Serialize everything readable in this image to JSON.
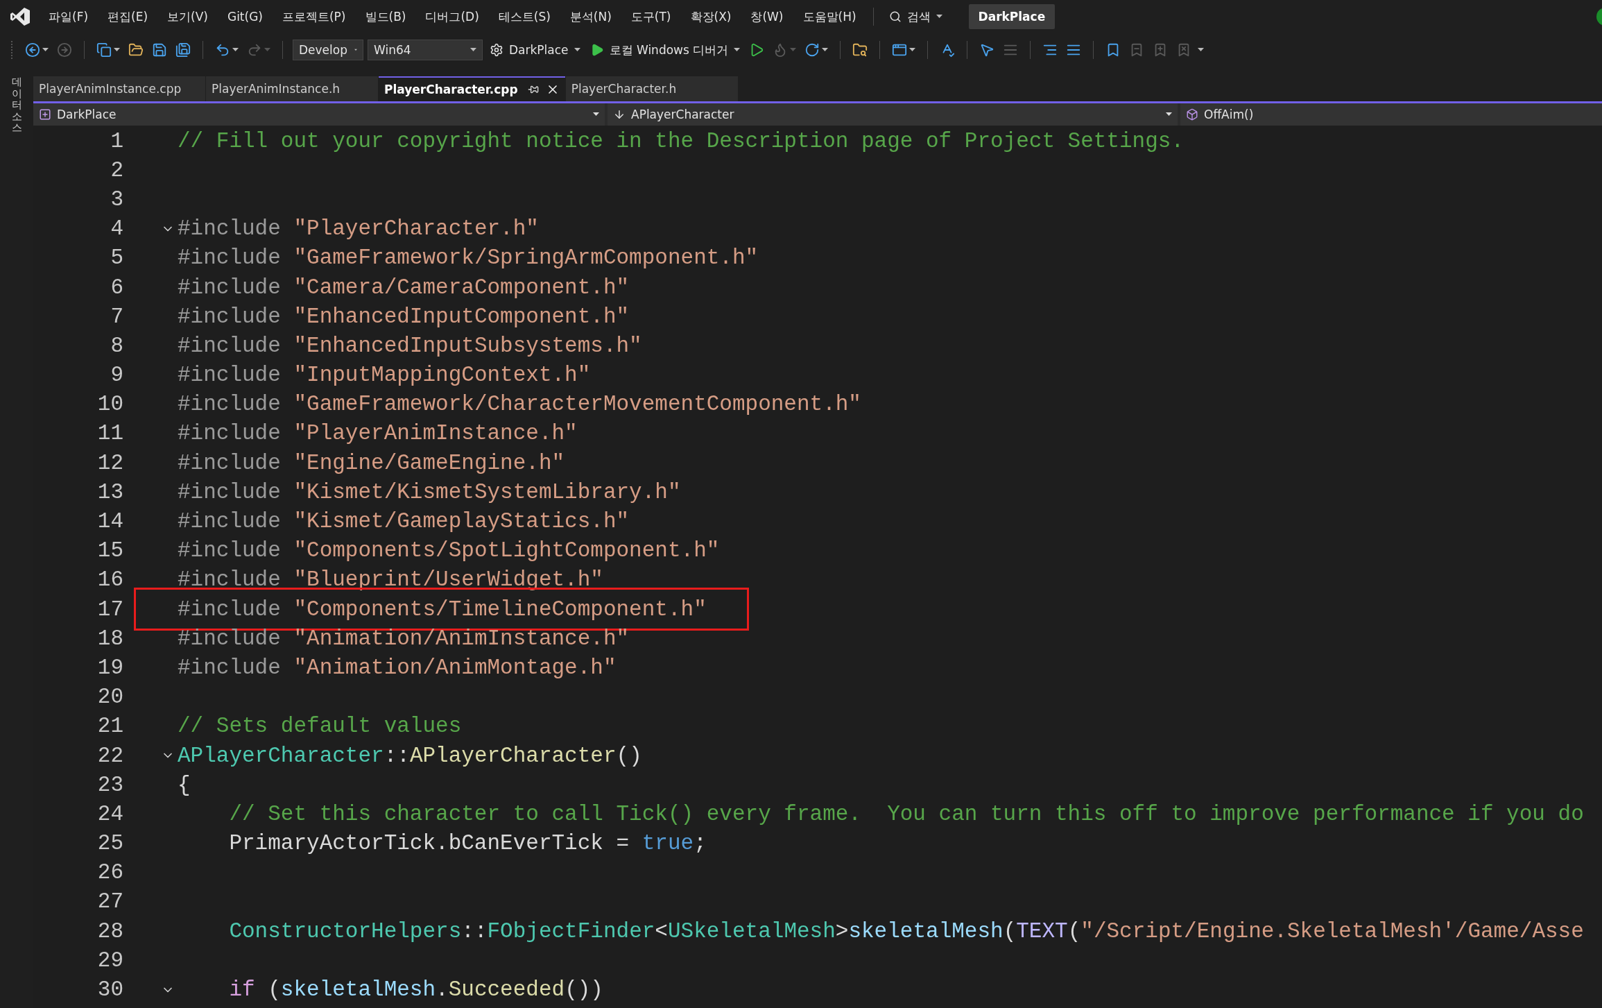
{
  "menu": [
    "파일(F)",
    "편집(E)",
    "보기(V)",
    "Git(G)",
    "프로젝트(P)",
    "빌드(B)",
    "디버그(D)",
    "테스트(S)",
    "분석(N)",
    "도구(T)",
    "확장(X)",
    "창(W)",
    "도움말(H)"
  ],
  "search": {
    "label": "검색"
  },
  "solution_badge": "DarkPlace",
  "toolbar": [
    {
      "kind": "back",
      "disabled": false
    },
    {
      "kind": "forward",
      "disabled": true
    },
    {
      "kind": "separator"
    },
    {
      "kind": "new-item",
      "disabled": false
    },
    {
      "kind": "open",
      "disabled": false
    },
    {
      "kind": "save",
      "disabled": false
    },
    {
      "kind": "save-all",
      "disabled": false
    },
    {
      "kind": "separator"
    },
    {
      "kind": "undo",
      "disabled": false
    },
    {
      "kind": "redo",
      "disabled": true
    },
    {
      "kind": "separator"
    },
    {
      "kind": "combo",
      "label": "Develop",
      "wide": false
    },
    {
      "kind": "combo",
      "label": "Win64",
      "wide": true
    },
    {
      "kind": "startup",
      "label": "DarkPlace"
    },
    {
      "kind": "start",
      "label": "로컬 Windows 디버거"
    },
    {
      "kind": "start-plain",
      "disabled": false
    },
    {
      "kind": "hot-reload",
      "disabled": true
    },
    {
      "kind": "restart",
      "disabled": false
    },
    {
      "kind": "separator"
    },
    {
      "kind": "folder-search",
      "disabled": false
    },
    {
      "kind": "separator"
    },
    {
      "kind": "window",
      "disabled": false
    },
    {
      "kind": "separator"
    },
    {
      "kind": "spell",
      "disabled": false
    },
    {
      "kind": "separator"
    },
    {
      "kind": "pointer",
      "disabled": false
    },
    {
      "kind": "format",
      "disabled": true
    },
    {
      "kind": "separator"
    },
    {
      "kind": "indent",
      "disabled": false
    },
    {
      "kind": "outdent",
      "disabled": false
    },
    {
      "kind": "separator"
    },
    {
      "kind": "bookmark",
      "disabled": false
    },
    {
      "kind": "bookmark-prev",
      "disabled": true
    },
    {
      "kind": "bookmark-next",
      "disabled": true
    },
    {
      "kind": "bookmark-clear",
      "disabled": true
    },
    {
      "kind": "overflow"
    }
  ],
  "side_panel": {
    "label": "데이터 소스"
  },
  "tabs": [
    {
      "label": "PlayerAnimInstance.cpp",
      "selected": false
    },
    {
      "label": "PlayerAnimInstance.h",
      "selected": false
    },
    {
      "label": "PlayerCharacter.cpp",
      "selected": true
    },
    {
      "label": "PlayerCharacter.h",
      "selected": false
    }
  ],
  "navigation": {
    "project": "DarkPlace",
    "scope": "APlayerCharacter",
    "member": "OffAim()"
  },
  "code": {
    "lines": [
      {
        "number": "1",
        "fold": false,
        "boxed": false,
        "tokens": [
          {
            "kind": "comment",
            "text": "// Fill out your copyright notice in the Description page of Project Settings."
          }
        ]
      },
      {
        "number": "2",
        "fold": false,
        "boxed": false
      },
      {
        "number": "3",
        "fold": false,
        "boxed": false
      },
      {
        "number": "4",
        "fold": true,
        "boxed": false,
        "tokens": [
          {
            "kind": "directive",
            "text": "#include "
          },
          {
            "kind": "string",
            "text": "\"PlayerCharacter.h\""
          }
        ]
      },
      {
        "number": "5",
        "fold": false,
        "boxed": false,
        "tokens": [
          {
            "kind": "directive",
            "text": "#include "
          },
          {
            "kind": "string",
            "text": "\"GameFramework/SpringArmComponent.h\""
          }
        ]
      },
      {
        "number": "6",
        "fold": false,
        "boxed": false,
        "tokens": [
          {
            "kind": "directive",
            "text": "#include "
          },
          {
            "kind": "string",
            "text": "\"Camera/CameraComponent.h\""
          }
        ]
      },
      {
        "number": "7",
        "fold": false,
        "boxed": false,
        "tokens": [
          {
            "kind": "directive",
            "text": "#include "
          },
          {
            "kind": "string",
            "text": "\"EnhancedInputComponent.h\""
          }
        ]
      },
      {
        "number": "8",
        "fold": false,
        "boxed": false,
        "tokens": [
          {
            "kind": "directive",
            "text": "#include "
          },
          {
            "kind": "string",
            "text": "\"EnhancedInputSubsystems.h\""
          }
        ]
      },
      {
        "number": "9",
        "fold": false,
        "boxed": false,
        "tokens": [
          {
            "kind": "directive",
            "text": "#include "
          },
          {
            "kind": "string",
            "text": "\"InputMappingContext.h\""
          }
        ]
      },
      {
        "number": "10",
        "fold": false,
        "boxed": false,
        "tokens": [
          {
            "kind": "directive",
            "text": "#include "
          },
          {
            "kind": "string",
            "text": "\"GameFramework/CharacterMovementComponent.h\""
          }
        ]
      },
      {
        "number": "11",
        "fold": false,
        "boxed": false,
        "tokens": [
          {
            "kind": "directive",
            "text": "#include "
          },
          {
            "kind": "string",
            "text": "\"PlayerAnimInstance.h\""
          }
        ]
      },
      {
        "number": "12",
        "fold": false,
        "boxed": false,
        "tokens": [
          {
            "kind": "directive",
            "text": "#include "
          },
          {
            "kind": "string",
            "text": "\"Engine/GameEngine.h\""
          }
        ]
      },
      {
        "number": "13",
        "fold": false,
        "boxed": false,
        "tokens": [
          {
            "kind": "directive",
            "text": "#include "
          },
          {
            "kind": "string",
            "text": "\"Kismet/KismetSystemLibrary.h\""
          }
        ]
      },
      {
        "number": "14",
        "fold": false,
        "boxed": false,
        "tokens": [
          {
            "kind": "directive",
            "text": "#include "
          },
          {
            "kind": "string",
            "text": "\"Kismet/GameplayStatics.h\""
          }
        ]
      },
      {
        "number": "15",
        "fold": false,
        "boxed": false,
        "tokens": [
          {
            "kind": "directive",
            "text": "#include "
          },
          {
            "kind": "string",
            "text": "\"Components/SpotLightComponent.h\""
          }
        ]
      },
      {
        "number": "16",
        "fold": false,
        "boxed": false,
        "tokens": [
          {
            "kind": "directive",
            "text": "#include "
          },
          {
            "kind": "string",
            "text": "\"Blueprint/UserWidget.h\""
          }
        ]
      },
      {
        "number": "17",
        "fold": false,
        "boxed": true,
        "tokens": [
          {
            "kind": "directive",
            "text": "#include "
          },
          {
            "kind": "string",
            "text": "\"Components/TimelineComponent.h\""
          }
        ]
      },
      {
        "number": "18",
        "fold": false,
        "boxed": false,
        "tokens": [
          {
            "kind": "directive",
            "text": "#include "
          },
          {
            "kind": "string",
            "text": "\"Animation/AnimInstance.h\""
          }
        ]
      },
      {
        "number": "19",
        "fold": false,
        "boxed": false,
        "tokens": [
          {
            "kind": "directive",
            "text": "#include "
          },
          {
            "kind": "string",
            "text": "\"Animation/AnimMontage.h\""
          }
        ]
      },
      {
        "number": "20",
        "fold": false,
        "boxed": false
      },
      {
        "number": "21",
        "fold": false,
        "boxed": false,
        "tokens": [
          {
            "kind": "comment",
            "text": "// Sets default values"
          }
        ]
      },
      {
        "number": "22",
        "fold": true,
        "boxed": false,
        "tokens": [
          {
            "kind": "type",
            "text": "APlayerCharacter"
          },
          {
            "kind": "plain",
            "text": "::"
          },
          {
            "kind": "function",
            "text": "APlayerCharacter"
          },
          {
            "kind": "plain",
            "text": "()"
          }
        ]
      },
      {
        "number": "23",
        "fold": false,
        "boxed": false,
        "tokens": [
          {
            "kind": "plain",
            "text": "{"
          }
        ]
      },
      {
        "number": "24",
        "fold": false,
        "boxed": false,
        "tokens": [
          {
            "kind": "comment",
            "text": "    // Set this character to call Tick() every frame.  You can turn this off to improve performance if you do"
          }
        ]
      },
      {
        "number": "25",
        "fold": false,
        "boxed": false,
        "tokens": [
          {
            "kind": "plain",
            "text": "    PrimaryActorTick.bCanEverTick = "
          },
          {
            "kind": "keyword",
            "text": "true"
          },
          {
            "kind": "plain",
            "text": ";"
          }
        ]
      },
      {
        "number": "26",
        "fold": false,
        "boxed": false
      },
      {
        "number": "27",
        "fold": false,
        "boxed": false
      },
      {
        "number": "28",
        "fold": false,
        "boxed": false,
        "tokens": [
          {
            "kind": "type",
            "text": "    ConstructorHelpers"
          },
          {
            "kind": "plain",
            "text": "::"
          },
          {
            "kind": "type",
            "text": "FObjectFinder"
          },
          {
            "kind": "plain",
            "text": "<"
          },
          {
            "kind": "type",
            "text": "USkeletalMesh"
          },
          {
            "kind": "plain",
            "text": ">"
          },
          {
            "kind": "variable",
            "text": "skeletalMesh"
          },
          {
            "kind": "plain",
            "text": "("
          },
          {
            "kind": "macro",
            "text": "TEXT"
          },
          {
            "kind": "plain",
            "text": "("
          },
          {
            "kind": "string",
            "text": "\"/Script/Engine.SkeletalMesh'/Game/Asse"
          }
        ]
      },
      {
        "number": "29",
        "fold": false,
        "boxed": false
      },
      {
        "number": "30",
        "fold": true,
        "boxed": false,
        "tokens": [
          {
            "kind": "control",
            "text": "    if"
          },
          {
            "kind": "plain",
            "text": " ("
          },
          {
            "kind": "variable",
            "text": "skeletalMesh"
          },
          {
            "kind": "plain",
            "text": "."
          },
          {
            "kind": "function",
            "text": "Succeeded"
          },
          {
            "kind": "plain",
            "text": "())"
          }
        ]
      }
    ]
  }
}
